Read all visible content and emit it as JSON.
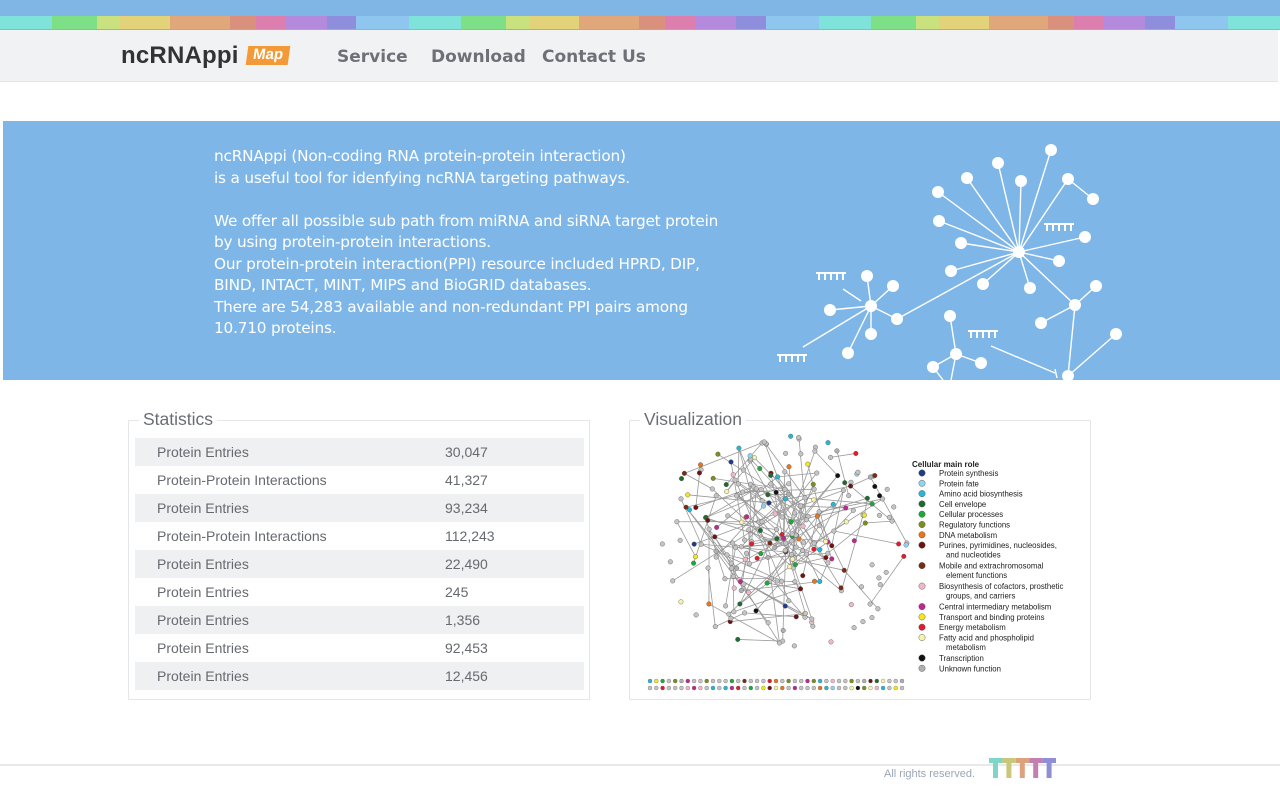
{
  "colors": {
    "top_bar": "#7fb6e6",
    "hero_background": "#7fb6e8",
    "map_badge": "#f29a37",
    "nav_text": "#6d7177",
    "stripes": [
      "#7fe3dc",
      "#7ddf86",
      "#c9e17e",
      "#e2d37b",
      "#e0a87a",
      "#d9907d",
      "#dd7fae",
      "#b48bdc",
      "#8e8edc",
      "#8fc6ef"
    ]
  },
  "header": {
    "logo": "ncRNAppi",
    "map_badge": "Map",
    "nav": [
      {
        "label": "Service"
      },
      {
        "label": "Download"
      },
      {
        "label": "Contact Us"
      }
    ]
  },
  "hero": {
    "lines": [
      "ncRNAppi (Non-coding RNA protein-protein interaction)",
      " is a useful tool for idenfying ncRNA targeting pathways.",
      "",
      "We offer all possible sub path from miRNA and siRNA target protein",
      "by using protein-protein interactions.",
      "Our protein-protein interaction(PPI) resource included HPRD, DIP,",
      "BIND, INTACT, MINT, MIPS and BioGRID databases.",
      "There are 54,283 available and non-redundant PPI pairs among",
      "10.710 proteins."
    ],
    "icon": "network-graph-icon"
  },
  "statistics": {
    "title": "Statistics",
    "rows": [
      {
        "label": "Protein Entries",
        "value": "30,047"
      },
      {
        "label": "Protein-Protein Interactions",
        "value": "41,327"
      },
      {
        "label": "Protein Entries",
        "value": "93,234"
      },
      {
        "label": "Protein-Protein Interactions",
        "value": "112,243"
      },
      {
        "label": "Protein Entries",
        "value": "22,490"
      },
      {
        "label": "Protein Entries",
        "value": "245"
      },
      {
        "label": "Protein Entries",
        "value": "1,356"
      },
      {
        "label": "Protein Entries",
        "value": "92,453"
      },
      {
        "label": "Protein Entries",
        "value": "12,456"
      }
    ]
  },
  "visualization": {
    "title": "Visualization",
    "legend_title": "Cellular main role",
    "legend": [
      {
        "label": "Protein synthesis",
        "color": "#1f3c88"
      },
      {
        "label": "Protein fate",
        "color": "#8fd3f4"
      },
      {
        "label": "Amino acid biosynthesis",
        "color": "#25b7d6"
      },
      {
        "label": "Cell envelope",
        "color": "#1e6b2e"
      },
      {
        "label": "Cellular processes",
        "color": "#1fa83a"
      },
      {
        "label": "Regulatory functions",
        "color": "#7a8f1c"
      },
      {
        "label": "DNA metabolism",
        "color": "#e8761c"
      },
      {
        "label": "Purines, pyrimidines, nucleosides,\nand nucleotides",
        "color": "#6b1414"
      },
      {
        "label": "Mobile and extrachromosomal\nelement functions",
        "color": "#7a2b12"
      },
      {
        "label": "Biosynthesis of cofactors, prosthetic\ngroups, and carriers",
        "color": "#f2b8c6"
      },
      {
        "label": "Central intermediary metabolism",
        "color": "#c0288f"
      },
      {
        "label": "Transport and binding proteins",
        "color": "#f2e81c"
      },
      {
        "label": "Energy metabolism",
        "color": "#e21c2e"
      },
      {
        "label": "Fatty acid and phospholipid\nmetabolism",
        "color": "#f7f3a8"
      },
      {
        "label": "Transcription",
        "color": "#111111"
      },
      {
        "label": "Unknown function",
        "color": "#b0b0b0"
      }
    ]
  },
  "footer": {
    "text": "All rights reserved.",
    "logo_colors": [
      "#7fd6c7",
      "#c9c87a",
      "#dda27d",
      "#c27fb0",
      "#8f8fd6"
    ]
  }
}
